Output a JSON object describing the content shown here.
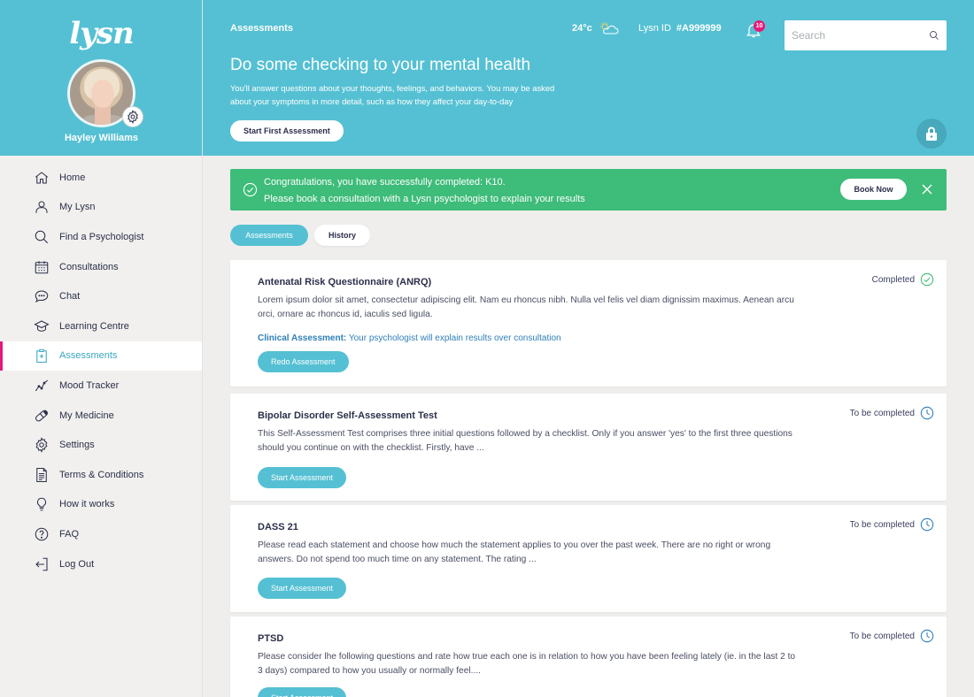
{
  "app": {
    "logo": "lysn"
  },
  "user": {
    "name": "Hayley Williams"
  },
  "sidebar": {
    "items": [
      {
        "label": "Home",
        "icon": "home-icon"
      },
      {
        "label": "My Lysn",
        "icon": "user-icon"
      },
      {
        "label": "Find a Psychologist",
        "icon": "search-icon"
      },
      {
        "label": "Consultations",
        "icon": "calendar-icon"
      },
      {
        "label": "Chat",
        "icon": "chat-icon"
      },
      {
        "label": "Learning Centre",
        "icon": "graduation-cap-icon"
      },
      {
        "label": "Assessments",
        "icon": "clipboard-icon",
        "active": true
      },
      {
        "label": "Mood Tracker",
        "icon": "trend-line-icon"
      },
      {
        "label": "My Medicine",
        "icon": "pill-icon"
      },
      {
        "label": "Settings",
        "icon": "gear-icon"
      },
      {
        "label": "Terms & Conditions",
        "icon": "document-icon"
      },
      {
        "label": "How it works",
        "icon": "lightbulb-icon"
      },
      {
        "label": "FAQ",
        "icon": "question-icon"
      },
      {
        "label": "Log Out",
        "icon": "logout-icon"
      }
    ]
  },
  "header": {
    "breadcrumb": "Assessments",
    "temperature": "24°c",
    "lysn_id_label": "Lysn ID",
    "lysn_id_value": "#A999999",
    "notification_count": "10",
    "search_placeholder": "Search",
    "title": "Do some checking to your mental health",
    "description": "You'll answer questions about your thoughts, feelings, and behaviors. You may be asked about your symptoms in more detail, such as how they affect your day-to-day",
    "start_button": "Start First Assessment"
  },
  "banner": {
    "line1": "Congratulations, you have successfully completed: K10.",
    "line2": "Please book a consultation with a Lysn psychologist to explain your results",
    "button": "Book Now"
  },
  "tabs": {
    "assessments": "Assessments",
    "history": "History"
  },
  "assessments": [
    {
      "title": "Antenatal Risk Questionnaire (ANRQ)",
      "description": "Lorem ipsum dolor sit amet, consectetur adipiscing elit. Nam eu rhoncus nibh. Nulla vel felis vel diam dignissim maximus. Aenean arcu orci, ornare ac rhoncus id, iaculis sed ligula.",
      "clinical_label": "Clinical Assessment:",
      "clinical_text": "Your psychologist will explain results over consultation",
      "status": "Completed",
      "button": "Redo Assessment"
    },
    {
      "title": "Bipolar Disorder Self-Assessment Test",
      "description": "This Self-Assessment Test comprises three initial questions followed by a checklist. Only if you answer 'yes' to the first three questions should you continue on with the checklist. Firstly, have ...",
      "status": "To be completed",
      "button": "Start Assessment"
    },
    {
      "title": "DASS 21",
      "description": "Please read each statement and choose how much the statement applies to you over the past week. There are no right or wrong answers. Do not spend too much time on any statement. The rating ...",
      "status": "To be completed",
      "button": "Start Assessment"
    },
    {
      "title": "PTSD",
      "description": "Please consider lhe following questions and rate how true each one is in relation to how you have been feeling lately (ie. in the last 2 to 3 days) compared to how you usually or normally feel....",
      "status": "To be completed",
      "button": "Start Assessment"
    }
  ],
  "colors": {
    "brand": "#55c0d3",
    "success": "#3ebc79",
    "accent": "#e6197a"
  }
}
